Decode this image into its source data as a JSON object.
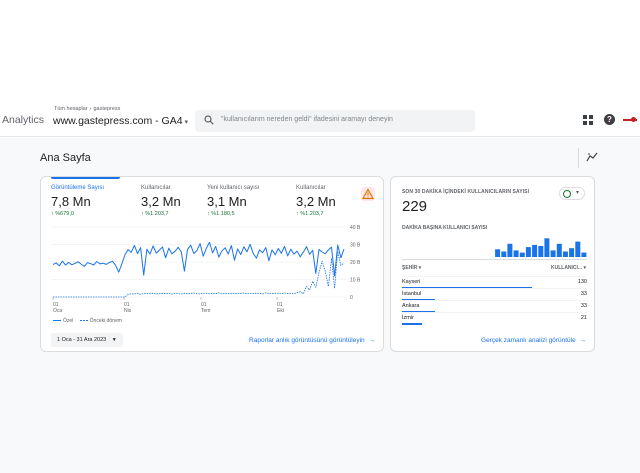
{
  "header": {
    "app_name": "Analytics",
    "breadcrumb": [
      "Tüm hesaplar",
      "gastepress"
    ],
    "property": "www.gastepress.com - GA4",
    "search_placeholder": "\"kullanıcılarım nereden geldi\" ifadesini aramayı deneyin",
    "icons": [
      "apps-icon",
      "help-icon",
      "menu-icon"
    ]
  },
  "page": {
    "title": "Ana Sayfa"
  },
  "overview": {
    "metrics": [
      {
        "label": "Görüntüleme Sayısı",
        "value": "7,8 Mn",
        "change": "↑ %679,0",
        "active": true
      },
      {
        "label": "Kullanıcılar",
        "value": "3,2 Mn",
        "change": "↑ %1.203,7"
      },
      {
        "label": "Yeni kullanıcı sayısı",
        "value": "3,1 Mn",
        "change": "↑ %1.180,5"
      },
      {
        "label": "Kullanıcılar",
        "value": "3,2 Mn",
        "change": "↑ %1.203,7"
      }
    ],
    "legend_current": "Özel",
    "legend_previous": "Önceki dönem",
    "date_range": "1 Oca - 31 Ara 2023",
    "link": "Raporlar anlık görüntüsünü görüntüleyin"
  },
  "chart_data": {
    "type": "line",
    "title": "",
    "x_ticks": [
      {
        "day": "01",
        "month": "Oca"
      },
      {
        "day": "01",
        "month": "Nis"
      },
      {
        "day": "01",
        "month": "Tem"
      },
      {
        "day": "01",
        "month": "Eki"
      }
    ],
    "y_ticks": [
      "40 B",
      "30 B",
      "20 B",
      "10 B",
      "0"
    ],
    "ylim": [
      0,
      40000
    ],
    "grid": true,
    "series": [
      {
        "name": "Özel",
        "style": "solid",
        "values": [
          18500,
          19500,
          17800,
          20500,
          18200,
          19800,
          18400,
          19200,
          20100,
          18800,
          17500,
          19600,
          19100,
          18300,
          20200,
          18900,
          19300,
          18600,
          19700,
          20400,
          18100,
          14200,
          18800,
          24200,
          27100,
          25500,
          29500,
          24800,
          28200,
          12500,
          27300,
          24500,
          29200,
          25100,
          26800,
          28600,
          22400,
          27900,
          24700,
          26100,
          28400,
          25800,
          14800,
          27200,
          29600,
          24900,
          26500,
          30500,
          23300,
          27800,
          31200,
          25200,
          28900,
          22800,
          26400,
          28100,
          24600,
          29400,
          21000,
          27500,
          24300,
          28700,
          25900,
          30100,
          24800,
          22200,
          27000,
          25300,
          28300,
          20700,
          26900,
          24100,
          27700,
          25000,
          29000,
          23500,
          27300,
          24500,
          26200,
          22900,
          25600,
          28800,
          24400,
          26600,
          13500,
          27200,
          25700,
          24700,
          26900,
          28500,
          12000,
          29700,
          22400,
          27400
        ]
      },
      {
        "name": "Önceki dönem",
        "style": "dashed",
        "values": [
          0,
          0,
          0,
          0,
          0,
          0,
          0,
          0,
          0,
          0,
          0,
          0,
          0,
          0,
          0,
          0,
          0,
          0,
          0,
          0,
          0,
          0,
          0,
          0,
          1500,
          1800,
          1700,
          2100,
          1600,
          1900,
          2000,
          1800,
          2200,
          1700,
          1900,
          2100,
          1800,
          2000,
          1600,
          2200,
          1900,
          1700,
          2100,
          1800,
          2000,
          2300,
          1900,
          1700,
          2100,
          2200,
          1800,
          2000,
          1900,
          2400,
          1700,
          2100,
          2000,
          1800,
          2200,
          1900,
          2100,
          2300,
          1800,
          2000,
          1900,
          2200,
          2100,
          1700,
          2400,
          2000,
          1900,
          2200,
          2100,
          1800,
          2300,
          2000,
          2100,
          1900,
          2500,
          3000,
          1800,
          6000,
          4000,
          9000,
          5500,
          14000,
          20500,
          15000,
          6000,
          22000,
          5000,
          26000,
          18000,
          19500
        ]
      }
    ]
  },
  "realtime": {
    "title": "SON 30 DAKİKA İÇİNDEKİ KULLANICILARIN SAYISI",
    "value": "229",
    "subtitle": "DAKİKA BAŞINA KULLANICI SAYISI",
    "minute_bars": [
      0.0,
      0.0,
      0.0,
      0.0,
      0.0,
      0.0,
      0.0,
      0.0,
      0.0,
      0.0,
      0.0,
      0.0,
      0.0,
      0.0,
      0.0,
      0.0,
      0.0,
      0.0,
      0.0,
      0.0,
      0.0,
      0.0,
      0.0,
      0.0,
      0.0,
      0.0,
      0.0,
      0.0,
      0.0,
      0.0
    ],
    "col_city": "ŞEHİR",
    "col_users": "KULLANICI...",
    "rows": [
      {
        "city": "Kayseri",
        "users": "130",
        "share": 0.7
      },
      {
        "city": "İstanbul",
        "users": "33",
        "share": 0.18
      },
      {
        "city": "Ankara",
        "users": "33",
        "share": 0.18
      },
      {
        "city": "İzmir",
        "users": "21",
        "share": 0.11
      }
    ],
    "link": "Gerçek zamanlı analizi görüntüle"
  },
  "colors": {
    "accent": "#1a73e8",
    "positive": "#137333",
    "warning": "#e37400"
  }
}
